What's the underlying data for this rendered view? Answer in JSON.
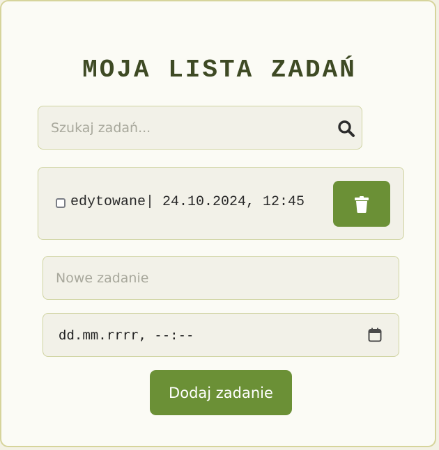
{
  "app": {
    "title": "MOJA LISTA ZADAŃ"
  },
  "search": {
    "placeholder": "Szukaj zadań...",
    "value": "",
    "icon": "search-icon"
  },
  "tasks": [
    {
      "checked": false,
      "text": "edytowane| 24.10.2024, 12:45",
      "delete_icon": "trash-icon"
    }
  ],
  "new_task": {
    "placeholder": "Nowe zadanie",
    "value": ""
  },
  "deadline": {
    "placeholder_text": "dd.mm.rrrr, --:--",
    "icon": "calendar-icon"
  },
  "add_button": {
    "label": "Dodaj zadanie"
  },
  "colors": {
    "accent": "#6b9036",
    "title": "#3e4a24",
    "border": "#cfd3a0",
    "field_bg": "#f2f1e8",
    "card_bg": "#fbfbf5"
  }
}
